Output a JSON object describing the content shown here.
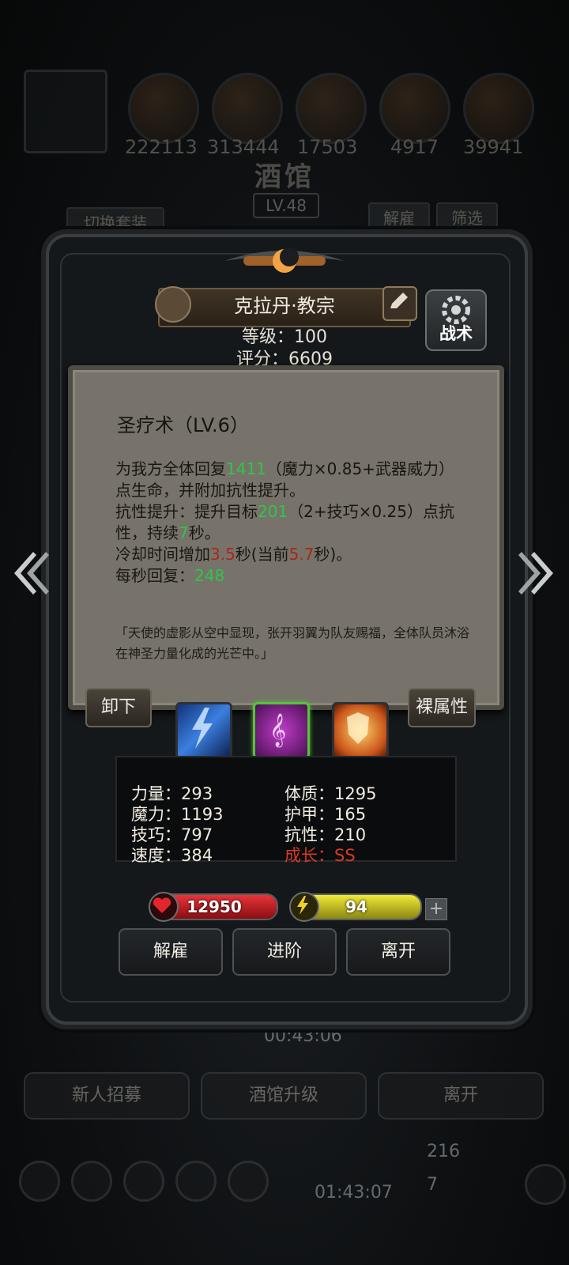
{
  "background": {
    "resources": [
      "222113",
      "313444",
      "17503",
      "4917",
      "39941"
    ],
    "title": "酒馆",
    "level": "LV.48",
    "switch_outfit": "切换套装",
    "dismiss": "解雇",
    "filter": "筛选",
    "timer_top": "00:43:06",
    "bottom_buttons": [
      "新人招募",
      "酒馆升级",
      "离开"
    ],
    "timer_bottom": "01:43:07",
    "count_a": "216",
    "count_b": "7"
  },
  "hero": {
    "name": "克拉丹·教宗",
    "level_text": "等级：100",
    "score_text": "评分：6609",
    "tactics_label": "战术"
  },
  "skill_tooltip": {
    "title": "圣疗术（LV.6）",
    "l1a": "为我方全体回复",
    "l1_heal": "1411",
    "l1b": "（魔力×0.85+武器威力）点生命，并附加抗性提升。",
    "l2a": "抗性提升：提升目标",
    "l2_res": "201",
    "l2b": "（2+技巧×0.25）点抗性，持续",
    "l2_dur": "7",
    "l2c": "秒。",
    "l3a": "冷却时间增加",
    "l3_cd": "3.5",
    "l3b": "秒(当前",
    "l3_cur": "5.7",
    "l3c": "秒)。",
    "l4a": "每秒回复：",
    "l4_val": "248",
    "quote": "「天使的虚影从空中显现，张开羽翼为队友赐福，全体队员沐浴在神圣力量化成的光芒中。」"
  },
  "skills_row": {
    "unequip": "卸下",
    "bare_attr": "裸属性",
    "icons": [
      "lightning-skill-icon",
      "music-note-skill-icon",
      "holy-shield-skill-icon"
    ],
    "selected_index": 1
  },
  "attributes": {
    "strength": "力量：293",
    "magic": "魔力：1193",
    "skill": "技巧：797",
    "speed": "速度：384",
    "constitution": "体质：1295",
    "armor": "护甲：165",
    "resistance": "抗性：210",
    "growth": "成长：SS"
  },
  "status": {
    "hp": "12950",
    "energy": "94",
    "hp_color": "#c1161b",
    "energy_color": "#d8d21c"
  },
  "actions": {
    "dismiss": "解雇",
    "advance": "进阶",
    "leave": "离开"
  }
}
